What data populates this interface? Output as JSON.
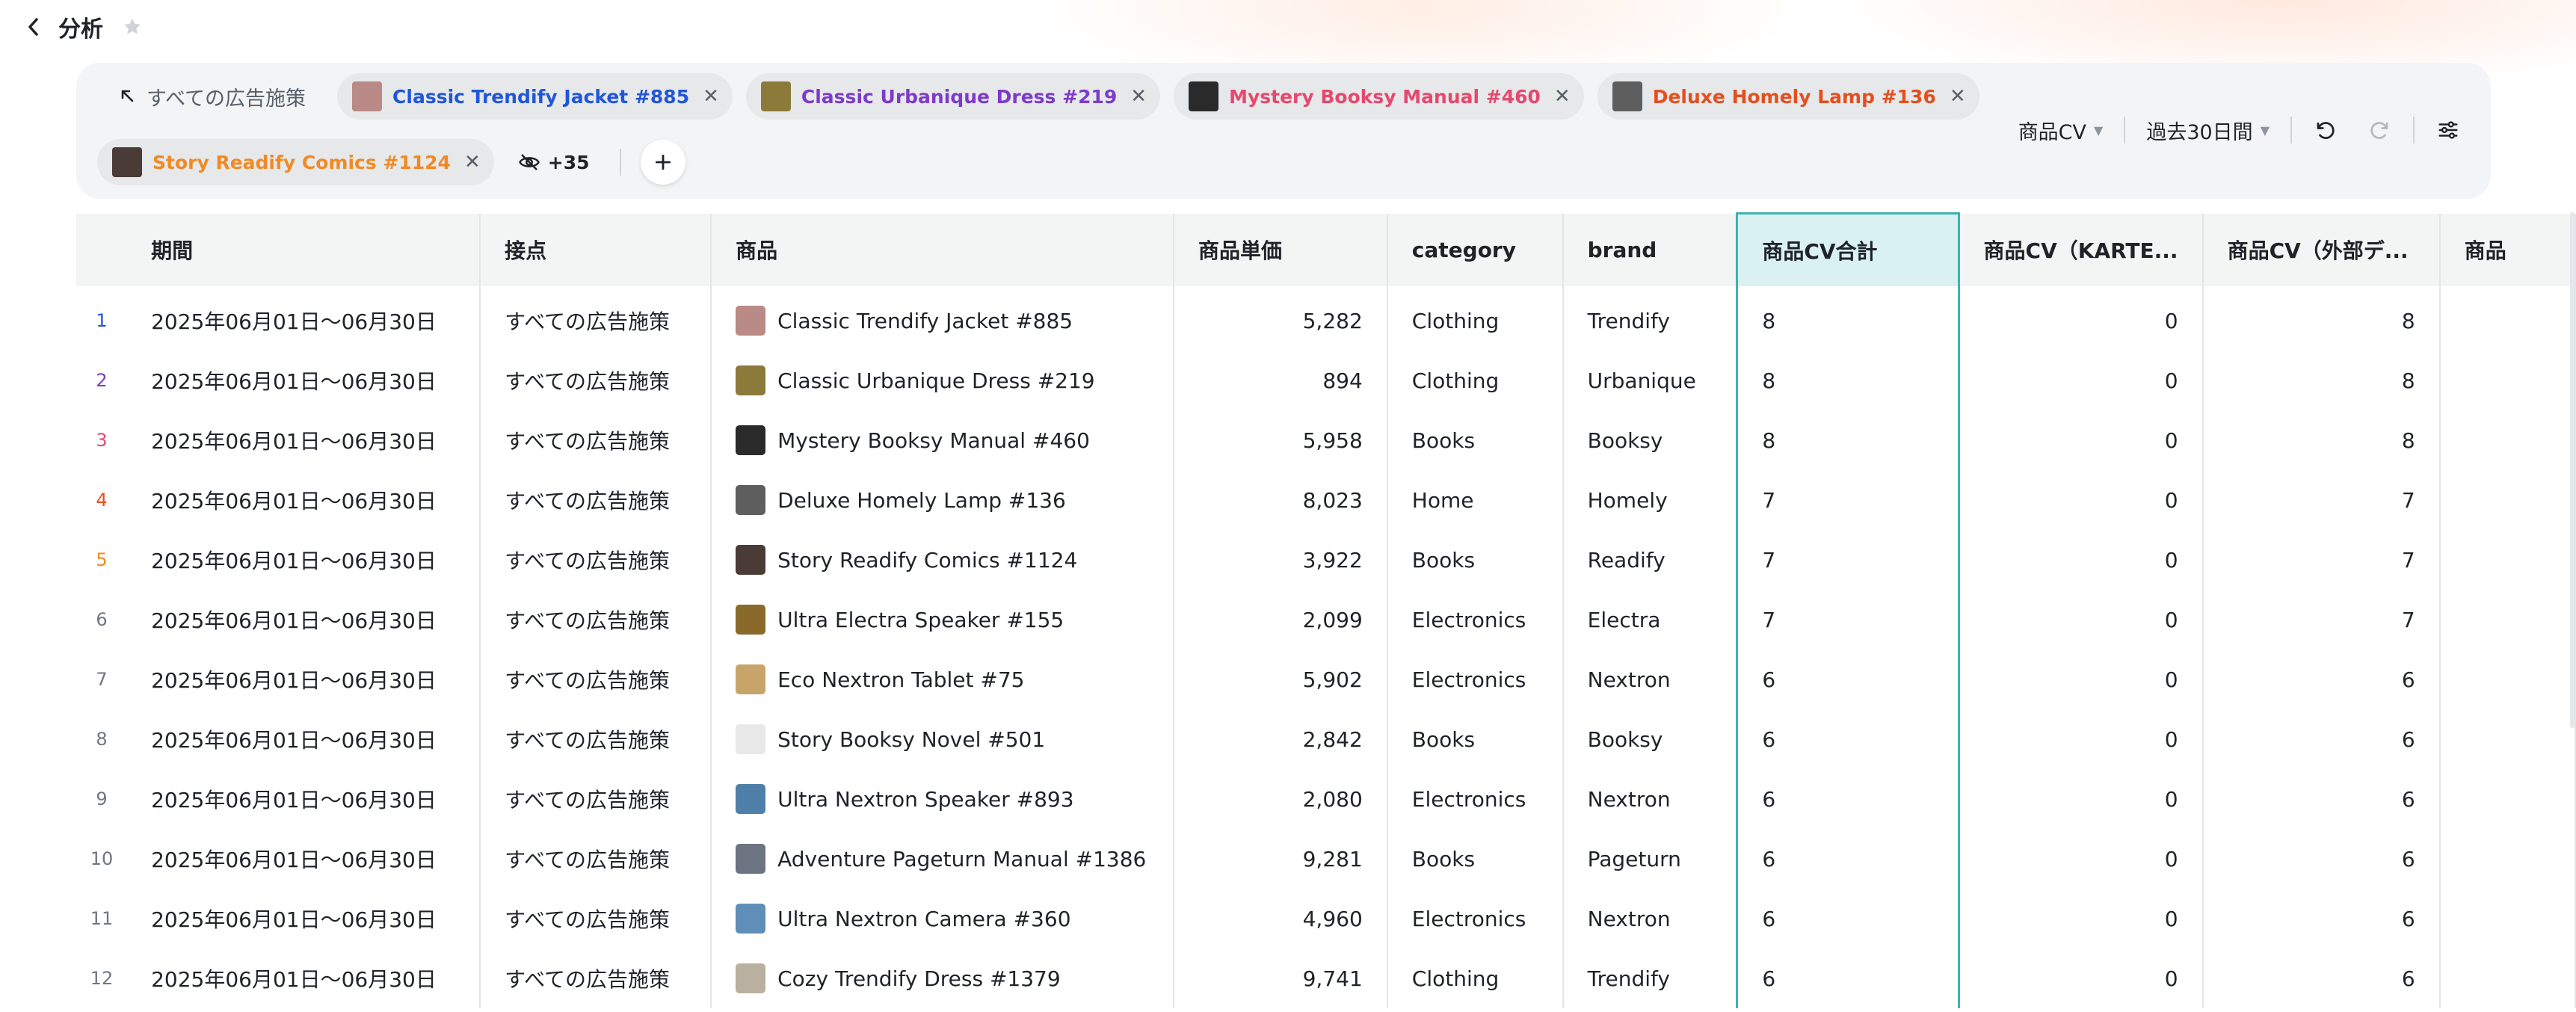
{
  "header": {
    "title": "分析"
  },
  "filters": {
    "all_ads_label": "すべての広告施策",
    "chips": [
      {
        "label": "Classic Trendify Jacket #885",
        "color": "#2156d9",
        "thumb": "#b98a86"
      },
      {
        "label": "Classic Urbanique Dress #219",
        "color": "#7d3bc9",
        "thumb": "#8b7a3a"
      },
      {
        "label": "Mystery Booksy Manual #460",
        "color": "#e6486e",
        "thumb": "#2a2a2a"
      },
      {
        "label": "Deluxe Homely Lamp #136",
        "color": "#e2501f",
        "thumb": "#5e5e5e"
      },
      {
        "label": "Story Readify Comics #1124",
        "color": "#f08a24",
        "thumb": "#4a3b36"
      }
    ],
    "hidden_count": "+35",
    "metric_dropdown": "商品CV",
    "period_dropdown": "過去30日間"
  },
  "table": {
    "columns": [
      "期間",
      "接点",
      "商品",
      "商品単価",
      "category",
      "brand",
      "商品CV合計",
      "商品CV（KARTE...",
      "商品CV（外部デ...",
      "商品"
    ],
    "rows": [
      {
        "idx": "1",
        "idx_color": "#2156d9",
        "period": "2025年06月01日〜06月30日",
        "touchpoint": "すべての広告施策",
        "product": "Classic Trendify Jacket #885",
        "thumb": "#b98a86",
        "price": "5,282",
        "category": "Clothing",
        "brand": "Trendify",
        "cv_total": "8",
        "cv_karte": "0",
        "cv_ext": "8"
      },
      {
        "idx": "2",
        "idx_color": "#7d3bc9",
        "period": "2025年06月01日〜06月30日",
        "touchpoint": "すべての広告施策",
        "product": "Classic Urbanique Dress #219",
        "thumb": "#8b7a3a",
        "price": "894",
        "category": "Clothing",
        "brand": "Urbanique",
        "cv_total": "8",
        "cv_karte": "0",
        "cv_ext": "8"
      },
      {
        "idx": "3",
        "idx_color": "#e6486e",
        "period": "2025年06月01日〜06月30日",
        "touchpoint": "すべての広告施策",
        "product": "Mystery Booksy Manual #460",
        "thumb": "#2a2a2a",
        "price": "5,958",
        "category": "Books",
        "brand": "Booksy",
        "cv_total": "8",
        "cv_karte": "0",
        "cv_ext": "8"
      },
      {
        "idx": "4",
        "idx_color": "#e2501f",
        "period": "2025年06月01日〜06月30日",
        "touchpoint": "すべての広告施策",
        "product": "Deluxe Homely Lamp #136",
        "thumb": "#5e5e5e",
        "price": "8,023",
        "category": "Home",
        "brand": "Homely",
        "cv_total": "7",
        "cv_karte": "0",
        "cv_ext": "7"
      },
      {
        "idx": "5",
        "idx_color": "#f08a24",
        "period": "2025年06月01日〜06月30日",
        "touchpoint": "すべての広告施策",
        "product": "Story Readify Comics #1124",
        "thumb": "#4a3b36",
        "price": "3,922",
        "category": "Books",
        "brand": "Readify",
        "cv_total": "7",
        "cv_karte": "0",
        "cv_ext": "7"
      },
      {
        "idx": "6",
        "idx_color": "#6e7781",
        "period": "2025年06月01日〜06月30日",
        "touchpoint": "すべての広告施策",
        "product": "Ultra Electra Speaker #155",
        "thumb": "#8a6a2a",
        "price": "2,099",
        "category": "Electronics",
        "brand": "Electra",
        "cv_total": "7",
        "cv_karte": "0",
        "cv_ext": "7"
      },
      {
        "idx": "7",
        "idx_color": "#6e7781",
        "period": "2025年06月01日〜06月30日",
        "touchpoint": "すべての広告施策",
        "product": "Eco Nextron Tablet #75",
        "thumb": "#c9a46a",
        "price": "5,902",
        "category": "Electronics",
        "brand": "Nextron",
        "cv_total": "6",
        "cv_karte": "0",
        "cv_ext": "6"
      },
      {
        "idx": "8",
        "idx_color": "#6e7781",
        "period": "2025年06月01日〜06月30日",
        "touchpoint": "すべての広告施策",
        "product": "Story Booksy Novel #501",
        "thumb": "#e8e8e8",
        "price": "2,842",
        "category": "Books",
        "brand": "Booksy",
        "cv_total": "6",
        "cv_karte": "0",
        "cv_ext": "6"
      },
      {
        "idx": "9",
        "idx_color": "#6e7781",
        "period": "2025年06月01日〜06月30日",
        "touchpoint": "すべての広告施策",
        "product": "Ultra Nextron Speaker #893",
        "thumb": "#4e7fa8",
        "price": "2,080",
        "category": "Electronics",
        "brand": "Nextron",
        "cv_total": "6",
        "cv_karte": "0",
        "cv_ext": "6"
      },
      {
        "idx": "10",
        "idx_color": "#6e7781",
        "period": "2025年06月01日〜06月30日",
        "touchpoint": "すべての広告施策",
        "product": "Adventure Pageturn Manual #1386",
        "thumb": "#6b7480",
        "price": "9,281",
        "category": "Books",
        "brand": "Pageturn",
        "cv_total": "6",
        "cv_karte": "0",
        "cv_ext": "6"
      },
      {
        "idx": "11",
        "idx_color": "#6e7781",
        "period": "2025年06月01日〜06月30日",
        "touchpoint": "すべての広告施策",
        "product": "Ultra Nextron Camera #360",
        "thumb": "#5f8fb8",
        "price": "4,960",
        "category": "Electronics",
        "brand": "Nextron",
        "cv_total": "6",
        "cv_karte": "0",
        "cv_ext": "6"
      },
      {
        "idx": "12",
        "idx_color": "#6e7781",
        "period": "2025年06月01日〜06月30日",
        "touchpoint": "すべての広告施策",
        "product": "Cozy Trendify Dress #1379",
        "thumb": "#b9b0a0",
        "price": "9,741",
        "category": "Clothing",
        "brand": "Trendify",
        "cv_total": "6",
        "cv_karte": "0",
        "cv_ext": "6"
      }
    ]
  }
}
